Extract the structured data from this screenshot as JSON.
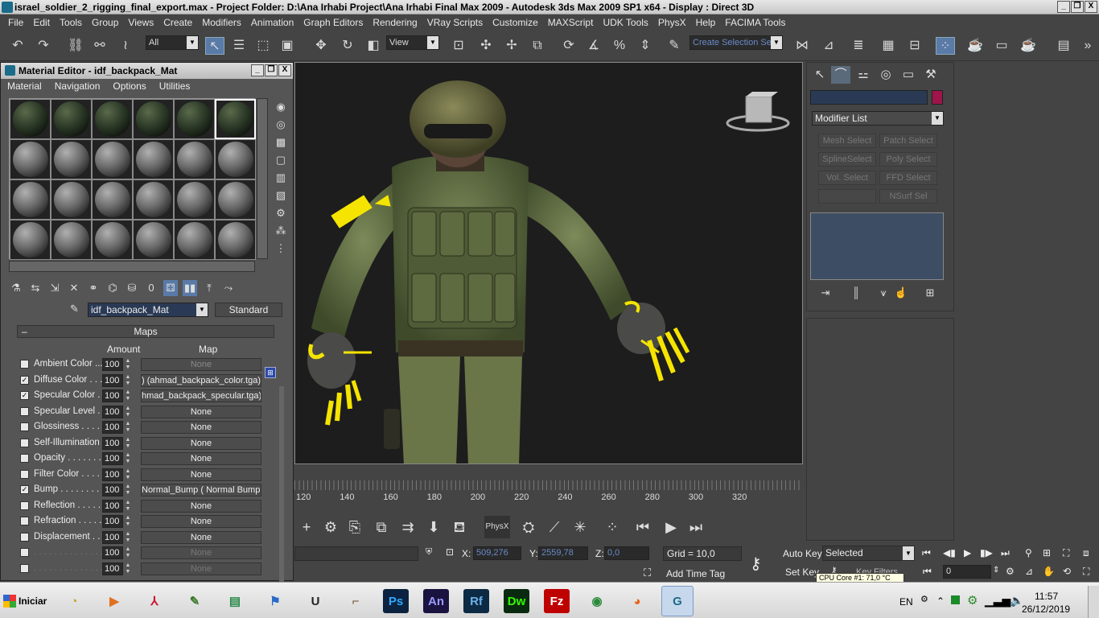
{
  "window": {
    "title": "israel_soldier_2_rigging_final_export.max    - Project Folder: D:\\Ana Irhabi Project\\Ana Irhabi Final Max 2009     - Autodesk 3ds Max  2009 SP1  x64       - Display : Direct 3D",
    "min": "_",
    "restore": "❐",
    "close": "X"
  },
  "menubar": [
    "File",
    "Edit",
    "Tools",
    "Group",
    "Views",
    "Create",
    "Modifiers",
    "Animation",
    "Graph Editors",
    "Rendering",
    "VRay Scripts",
    "Customize",
    "MAXScript",
    "UDK Tools",
    "PhysX",
    "Help",
    "FACIMA Tools"
  ],
  "toolbar": {
    "selection_filter": "All",
    "ref_coord": "View",
    "named_selection": "Create Selection Se"
  },
  "material_editor": {
    "title": "Material Editor - idf_backpack_Mat",
    "menu": [
      "Material",
      "Navigation",
      "Options",
      "Utilities"
    ],
    "material_name": "idf_backpack_Mat",
    "material_type": "Standard",
    "rollout_title": "Maps",
    "col_amount": "Amount",
    "col_map": "Map",
    "maps": [
      {
        "label": "Ambient Color ...",
        "checked": false,
        "amount": "100",
        "map": "None",
        "enabled": true,
        "dim_map": true
      },
      {
        "label": "Diffuse Color . . .",
        "checked": true,
        "amount": "100",
        "map": ") (ahmad_backpack_color.tga)",
        "enabled": true
      },
      {
        "label": "Specular Color . .",
        "checked": true,
        "amount": "100",
        "map": "hmad_backpack_specular.tga)",
        "enabled": true
      },
      {
        "label": "Specular Level . .",
        "checked": false,
        "amount": "100",
        "map": "None",
        "enabled": true
      },
      {
        "label": "Glossiness . . . . .",
        "checked": false,
        "amount": "100",
        "map": "None",
        "enabled": true
      },
      {
        "label": "Self-Illumination .",
        "checked": false,
        "amount": "100",
        "map": "None",
        "enabled": true
      },
      {
        "label": "Opacity . . . . . . . .",
        "checked": false,
        "amount": "100",
        "map": "None",
        "enabled": true
      },
      {
        "label": "Filter Color . . . . .",
        "checked": false,
        "amount": "100",
        "map": "None",
        "enabled": true
      },
      {
        "label": "Bump . . . . . . . . .",
        "checked": true,
        "amount": "100",
        "map": "Normal_Bump  ( Normal Bump )",
        "enabled": true
      },
      {
        "label": "Reflection . . . . . .",
        "checked": false,
        "amount": "100",
        "map": "None",
        "enabled": true
      },
      {
        "label": "Refraction . . . . . .",
        "checked": false,
        "amount": "100",
        "map": "None",
        "enabled": true
      },
      {
        "label": "Displacement . . .",
        "checked": false,
        "amount": "100",
        "map": "None",
        "enabled": true
      },
      {
        "label": ". . . . . . . . . . . . . .",
        "checked": false,
        "amount": "100",
        "map": "None",
        "enabled": false
      },
      {
        "label": ". . . . . . . . . . . . . .",
        "checked": false,
        "amount": "100",
        "map": "None",
        "enabled": false
      }
    ]
  },
  "timeline": {
    "ticks": [
      "120",
      "140",
      "160",
      "180",
      "200",
      "220",
      "240",
      "260",
      "280",
      "300",
      "320"
    ]
  },
  "status": {
    "x_label": "X:",
    "x_value": "509,276",
    "y_label": "Y:",
    "y_value": "2559,78",
    "z_label": "Z:",
    "z_value": "0,0",
    "grid": "Grid = 10,0",
    "add_time_tag": "Add Time Tag",
    "auto_key": "Auto Key",
    "set_key": "Set Key",
    "key_mode": "Selected",
    "key_filters": "Key Filters...",
    "frame": "0",
    "cpu": "CPU Core #1: 71,0 °C"
  },
  "command_panel": {
    "modifier_list": "Modifier List",
    "buttons": [
      "Mesh Select",
      "Patch Select",
      "SplineSelect",
      "Poly Select",
      "Vol. Select",
      "FFD Select",
      "",
      "NSurf Sel"
    ],
    "object_color": "#a0144c"
  },
  "taskbar": {
    "start": "Iniciar",
    "apps": [
      {
        "name": "speed-icon",
        "glyph": "◔",
        "color": "#c9a227"
      },
      {
        "name": "media-player-icon",
        "glyph": "▶",
        "color": "#e07020"
      },
      {
        "name": "pdf-reader-icon",
        "glyph": "⅄",
        "color": "#c8102e"
      },
      {
        "name": "sheet-editor-icon",
        "glyph": "✎",
        "color": "#3a7a2a"
      },
      {
        "name": "network-tool-icon",
        "glyph": "▤",
        "color": "#2a8a4a"
      },
      {
        "name": "windows-flag-icon",
        "glyph": "⚑",
        "color": "#2a6ac8"
      },
      {
        "name": "unreal-icon",
        "glyph": "U",
        "color": "#222222"
      },
      {
        "name": "rifle-icon",
        "glyph": "⌐",
        "color": "#6a4a2a"
      },
      {
        "name": "photoshop-icon",
        "glyph": "Ps",
        "color": "#31a8ff",
        "bg": "#0b2340"
      },
      {
        "name": "animate-icon",
        "glyph": "An",
        "color": "#9999ff",
        "bg": "#1a1340"
      },
      {
        "name": "flash-icon",
        "glyph": "Rf",
        "color": "#6ab0e8",
        "bg": "#0c2a44"
      },
      {
        "name": "dreamweaver-icon",
        "glyph": "Dw",
        "color": "#35fa00",
        "bg": "#0a2a10"
      },
      {
        "name": "filezilla-icon",
        "glyph": "Fz",
        "color": "#ffffff",
        "bg": "#bf0000"
      },
      {
        "name": "chrome-icon",
        "glyph": "◉",
        "color": "#2a8a3a"
      },
      {
        "name": "firefox-icon",
        "glyph": "◕",
        "color": "#e8651a"
      },
      {
        "name": "3dsmax-icon",
        "glyph": "G",
        "color": "#1b6b8a"
      }
    ],
    "language": "EN",
    "time": "11:57",
    "date": "26/12/2019"
  },
  "colors": {
    "accent_yellow": "#f5e400",
    "viewport_bg": "#1d1d1d",
    "ui_gray": "#444444"
  }
}
